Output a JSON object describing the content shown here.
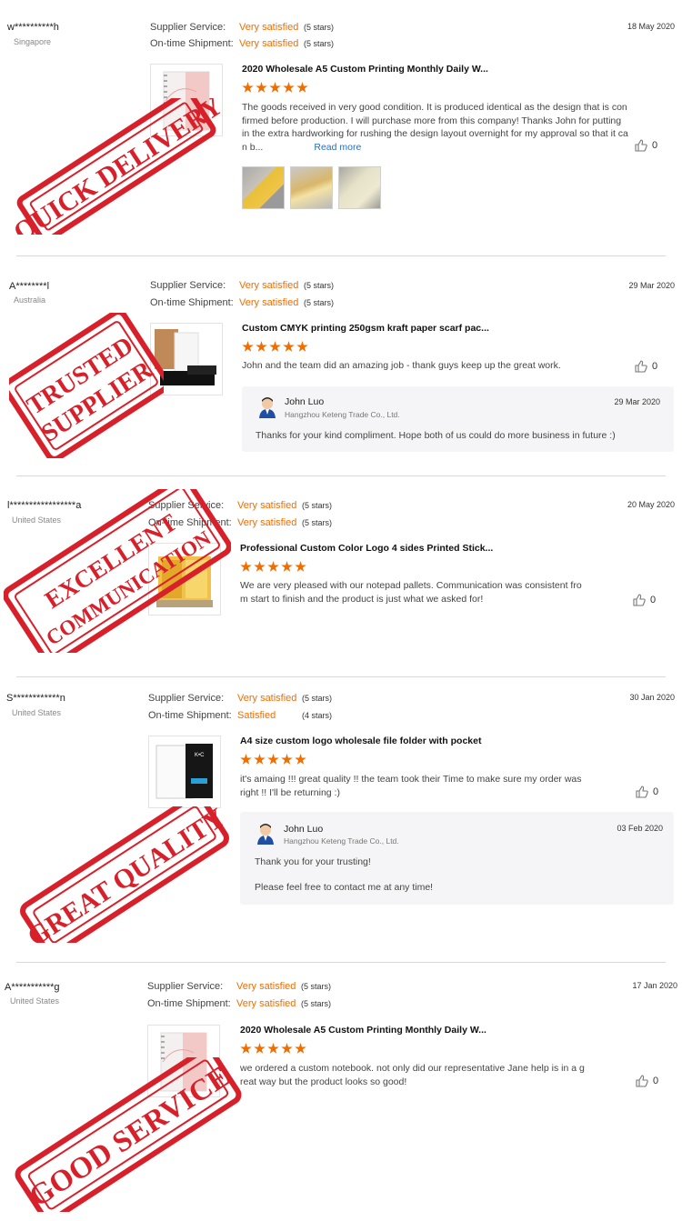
{
  "reviews": [
    {
      "user": "w**********h",
      "country": "Singapore",
      "date": "18 May 2020",
      "supplier_label": "Supplier Service:",
      "supplier_rating": "Very satisfied",
      "supplier_stars": "(5 stars)",
      "shipment_label": "On-time Shipment:",
      "shipment_rating": "Very satisfied",
      "shipment_stars": "(5 stars)",
      "product_title": "2020 Wholesale A5 Custom Printing Monthly Daily W...",
      "stars": 5,
      "text_lines": [
        "The goods received in very good condition. It is produced identical as the design that is con",
        "firmed before production. I will purchase more from this company! Thanks John for putting",
        "in the extra hardworking for rushing the design layout overnight for my approval so that it ca",
        "n b..."
      ],
      "read_more": "Read more",
      "likes": "0",
      "stamp": "QUICK DELIVERY"
    },
    {
      "user": "A********l",
      "country": "Australia",
      "date": "29 Mar 2020",
      "supplier_label": "Supplier Service:",
      "supplier_rating": "Very satisfied",
      "supplier_stars": "(5 stars)",
      "shipment_label": "On-time Shipment:",
      "shipment_rating": "Very satisfied",
      "shipment_stars": "(5 stars)",
      "product_title": "Custom CMYK printing 250gsm kraft paper scarf pac...",
      "stars": 5,
      "text_lines": [
        "John and the team did an amazing job - thank guys keep up the great work."
      ],
      "likes": "0",
      "stamp_lines": [
        "TRUSTED",
        "SUPPLIER"
      ],
      "reply": {
        "name": "John Luo",
        "company": "Hangzhou Keteng Trade Co., Ltd.",
        "date": "29 Mar 2020",
        "lines": [
          "Thanks for your kind compliment. Hope both of us could do more business in future :)"
        ]
      }
    },
    {
      "user": "l*****************a",
      "country": "United States",
      "date": "20 May 2020",
      "supplier_label": "Supplier Service:",
      "supplier_rating": "Very satisfied",
      "supplier_stars": "(5 stars)",
      "shipment_label": "On-time Shipment:",
      "shipment_rating": "Very satisfied",
      "shipment_stars": "(5 stars)",
      "product_title": "Professional Custom Color Logo 4 sides Printed Stick...",
      "stars": 5,
      "text_lines": [
        "We are very pleased with our notepad pallets. Communication was consistent fro",
        "m start to finish and the product is just what we asked for!"
      ],
      "likes": "0",
      "stamp_lines": [
        "EXCELLENT",
        "COMMUNICATION"
      ]
    },
    {
      "user": "S************n",
      "country": "United States",
      "date": "30 Jan 2020",
      "supplier_label": "Supplier Service:",
      "supplier_rating": "Very satisfied",
      "supplier_stars": "(5 stars)",
      "shipment_label": "On-time Shipment:",
      "shipment_rating": "Satisfied",
      "shipment_stars": "(4 stars)",
      "product_title": "A4 size custom logo wholesale file folder with pocket",
      "stars": 5,
      "text_lines": [
        "it's amaing !!! great quality !! the team took their Time to make sure my order was",
        "right !! I'll be returning :)"
      ],
      "likes": "0",
      "stamp": "GREAT QUALITY",
      "reply": {
        "name": "John Luo",
        "company": "Hangzhou Keteng Trade Co., Ltd.",
        "date": "03 Feb 2020",
        "lines": [
          "Thank you for your trusting!",
          "",
          "Please feel free to contact me at any time!"
        ]
      }
    },
    {
      "user": "A***********g",
      "country": "United States",
      "date": "17 Jan 2020",
      "supplier_label": "Supplier Service:",
      "supplier_rating": "Very satisfied",
      "supplier_stars": "(5 stars)",
      "shipment_label": "On-time Shipment:",
      "shipment_rating": "Very satisfied",
      "shipment_stars": "(5 stars)",
      "product_title": "2020 Wholesale A5 Custom Printing Monthly Daily W...",
      "stars": 5,
      "text_lines": [
        "we ordered a custom notebook. not only did our representative Jane help is in a g",
        "reat way but the product looks so good!"
      ],
      "likes": "0",
      "stamp": "GOOD SERVICE"
    }
  ],
  "colors": {
    "accent": "#f06d00",
    "stamp": "#d8202a",
    "link": "#1f70c6"
  },
  "icons": {
    "like": "thumbs-up-icon"
  }
}
